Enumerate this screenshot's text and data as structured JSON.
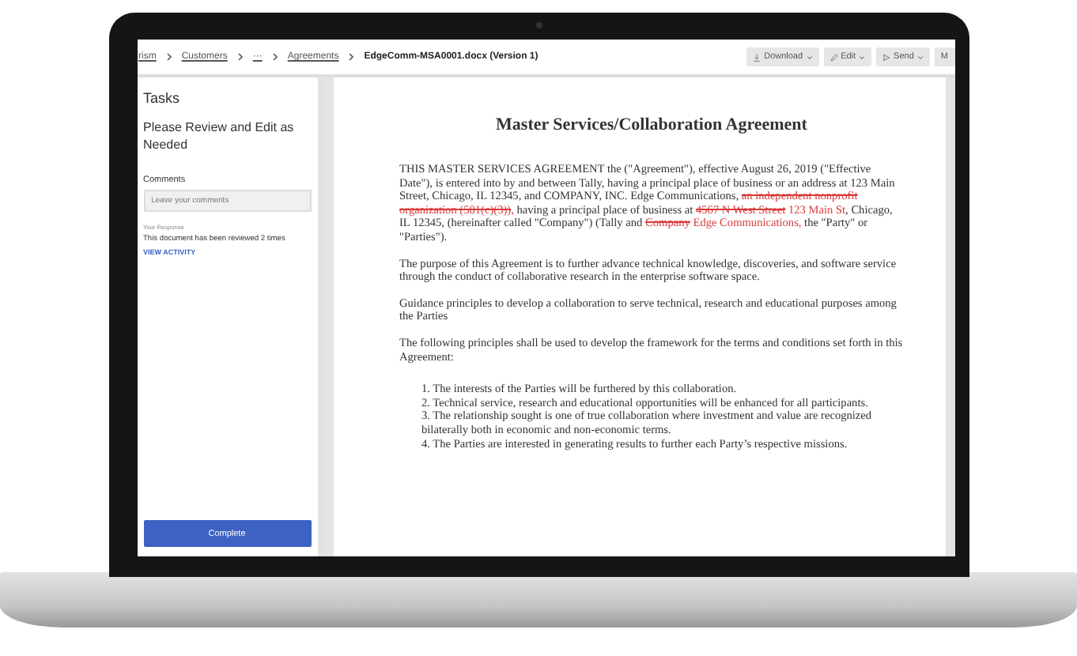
{
  "breadcrumb": [
    {
      "label": "rism",
      "current": false
    },
    {
      "label": "Customers",
      "current": false
    },
    {
      "label": "···",
      "current": false
    },
    {
      "label": "Agreements",
      "current": false
    },
    {
      "label": "EdgeComm-MSA0001.docx (Version 1)",
      "current": true
    }
  ],
  "toolbar": [
    {
      "label": "Download",
      "kind": "download"
    },
    {
      "label": "Edit",
      "kind": "edit"
    },
    {
      "label": "Send",
      "kind": "send"
    },
    {
      "label": "M",
      "kind": "plain"
    }
  ],
  "tasks": {
    "title": "Tasks",
    "task_title": "Please Review and Edit as Needed",
    "comments_label": "Comments",
    "comments_placeholder": "Leave your comments",
    "response_label": "Your Response",
    "response_text": "This document has been reviewed 2 times",
    "activity_link": "VIEW ACTIVITY",
    "complete_button": "Complete"
  },
  "document": {
    "title": "Master Services/Collaboration Agreement",
    "paragraphs": [
      [
        {
          "kind": "plain",
          "text": "THIS MASTER SERVICES AGREEMENT the (\"Agreement\"), effective August 26, 2019 (\"Effective Date\"), is entered into by and between Tally, having a principal place of business or an address at 123 Main Street, Chicago, IL 12345, and COMPANY, INC. Edge Communications, "
        },
        {
          "kind": "deleted",
          "text": "an independent nonprofit organization (501(c)(3))"
        },
        {
          "kind": "inserted",
          "text": ","
        },
        {
          "kind": "plain",
          "text": " having a principal place of business at "
        },
        {
          "kind": "deleted",
          "text": "4567 N West Street"
        },
        {
          "kind": "inserted",
          "text": " 123 Main St"
        },
        {
          "kind": "plain",
          "text": ", Chicago, IL 12345, (hereinafter called \"Company\") (Tally and "
        },
        {
          "kind": "deleted",
          "text": "Company"
        },
        {
          "kind": "inserted",
          "text": " Edge Communications,"
        },
        {
          "kind": "plain",
          "text": " the \"Party\" or \"Parties\")."
        }
      ],
      [
        {
          "kind": "plain",
          "text": "The purpose of this Agreement is to further advance technical knowledge, discoveries, and software service through the conduct of collaborative research in the enterprise software space."
        }
      ],
      [
        {
          "kind": "plain",
          "text": "Guidance principles to develop a collaboration to serve technical, research and educational purposes among the Parties"
        }
      ],
      [
        {
          "kind": "plain",
          "text": "The following principles shall be used to develop the framework for the terms and conditions set forth in this Agreement:"
        }
      ]
    ],
    "list": [
      "1.  The interests of the Parties will be furthered by this collaboration.",
      "2.  Technical service, research and educational opportunities will be enhanced for all participants.",
      "3.  The relationship sought is one of true collaboration where investment and value are recognized bilaterally both in economic and non-economic terms.",
      "4.  The Parties are interested in generating results to further each Party’s respective missions."
    ]
  }
}
